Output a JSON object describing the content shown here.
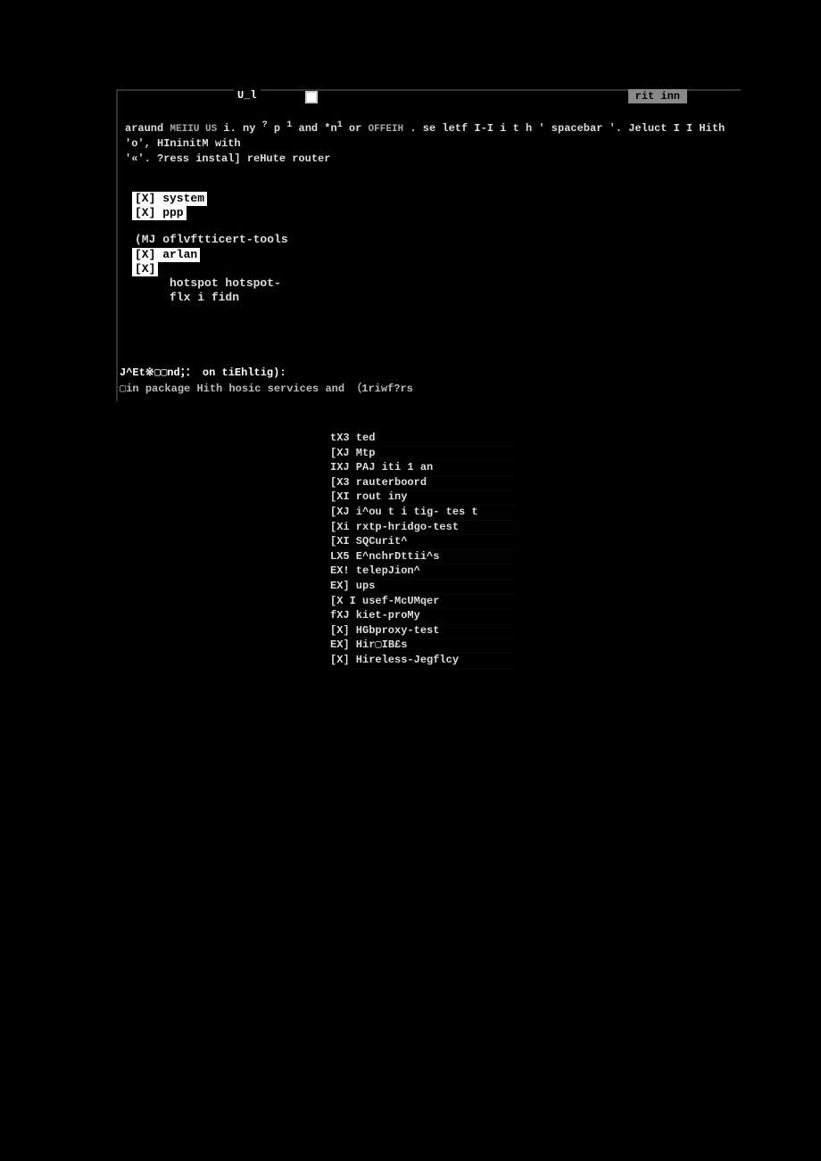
{
  "title": {
    "left_fragment": "U_l",
    "button_right": "rit inn"
  },
  "instructions": {
    "line1_a": "araund ",
    "line1_b": "MEIIU US",
    "line1_c": " i. ny ",
    "line1_d": "?",
    "line1_e": " p ",
    "line1_f": "1",
    "line1_g": " and *n",
    "line1_h": "1",
    "line1_i": " or ",
    "line1_j": "OFFEIH",
    "line1_k": " . se ",
    "line1_l": "letf I-I i t h ' spacebar '. Jeluct I I Hith 'o', HIninitM with",
    "line2": "'«'. ?ress instal] reHute router"
  },
  "packages_top": [
    {
      "label": "[X] system",
      "inverted": true
    },
    {
      "label": "[X] ppp",
      "inverted": true
    },
    {
      "label": "",
      "spacer": true
    },
    {
      "label": "(MJ oflvftticert-tools",
      "inverted": false
    },
    {
      "label": "[X] arlan",
      "inverted": true
    },
    {
      "label": "[X]",
      "inverted": true,
      "partial": true
    },
    {
      "label": "     hotspot hotspot-",
      "inverted": false,
      "indent": true
    },
    {
      "label": "     flx i fidn",
      "inverted": false,
      "indent": true
    }
  ],
  "depends": {
    "head": "J^Et※▢▢nd；：   on tiEhltig):",
    "sub": "▢in package Hith hosic services and （1riwf?rs"
  },
  "packages_bottom": [
    "tX3 ted",
    "[XJ Mtp",
    "IXJ PAJ iti 1 an",
    "[X3 rauterboord",
    "[XI rout iny",
    "[XJ i^ou t i tig- tes t",
    "[Xi rxtp-hridgo-test",
    "[XI SQCurit^",
    "LX5 E^nchrDttii^s",
    "EX! telepJion^",
    "EX] ups",
    "[X I usef-McUMqer",
    "fXJ kiet-proMy",
    "[X] HGbproxy-test",
    "EX] Hir▢IB£s",
    "[X] Hireless-Jegflcy"
  ]
}
